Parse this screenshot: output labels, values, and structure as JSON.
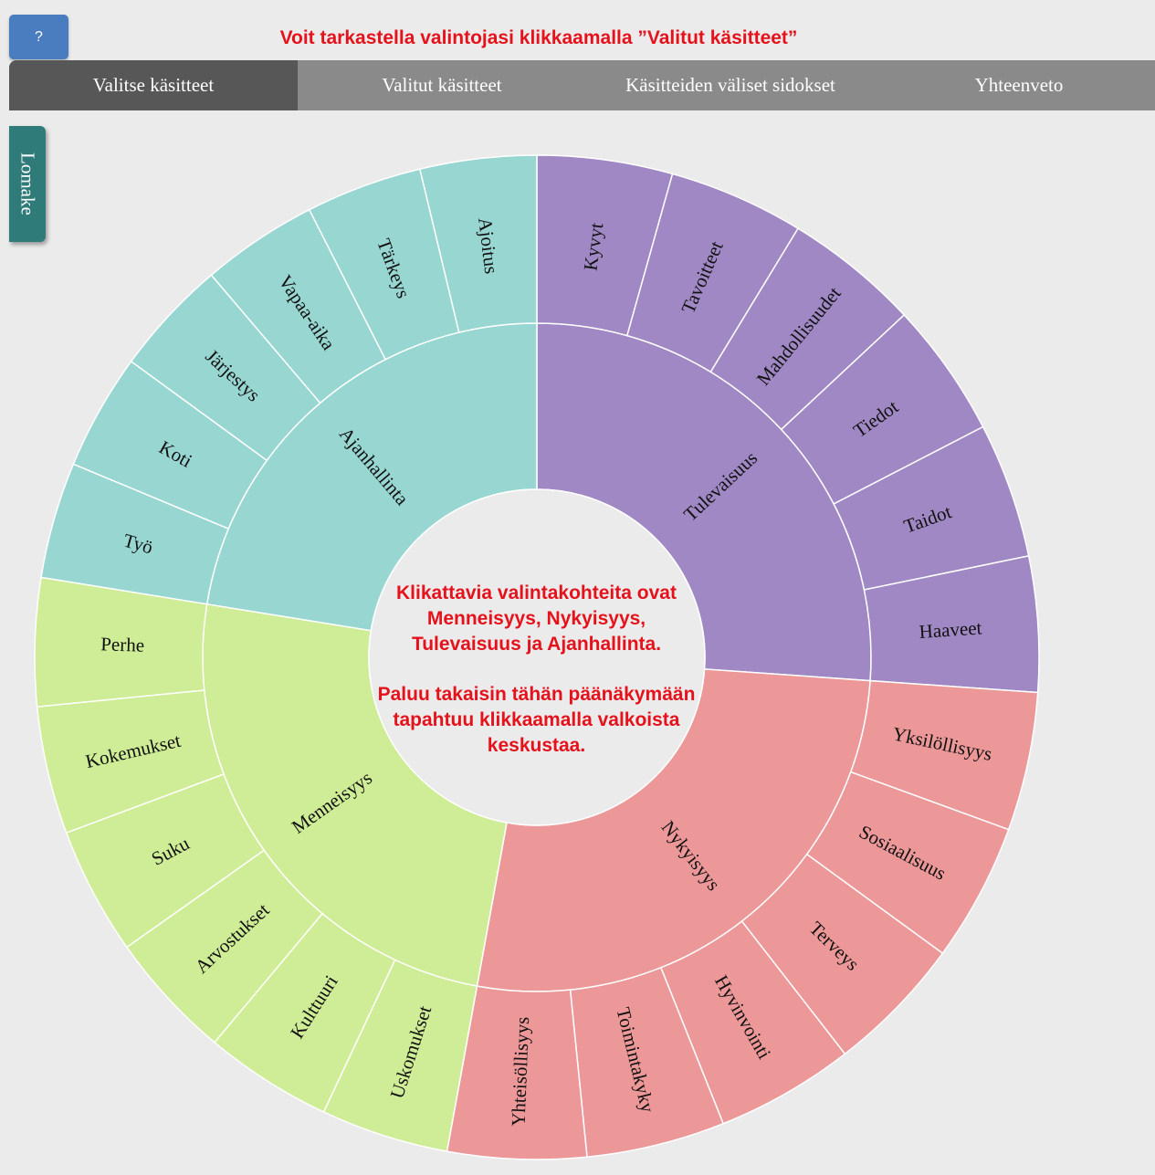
{
  "help_button": "?",
  "hint": "Voit tarkastella valintojasi klikkaamalla ”Valitut käsitteet”",
  "tabs": [
    "Valitse käsitteet",
    "Valitut käsitteet",
    "Käsitteiden väliset sidokset",
    "Yhteenveto"
  ],
  "active_tab": 0,
  "side_tab": "Lomake",
  "center": {
    "line1": "Klikattavia valintakohteita ovat Menneisyys, Nykyisyys, Tulevaisuus ja Ajanhallinta.",
    "line2": "Paluu takaisin tähän päänäkymään tapahtuu klikkaamalla valkoista keskustaa."
  },
  "colors": {
    "Tulevaisuus": "#a088c4",
    "Nykyisyys": "#ec9798",
    "Menneisyys": "#cfec96",
    "Ajanhallinta": "#98d6d2",
    "hint": "#e5121c"
  },
  "sunburst": [
    {
      "name": "Tulevaisuus",
      "children": [
        "Kyvyt",
        "Tavoitteet",
        "Mahdollisuudet",
        "Tiedot",
        "Taidot",
        "Haaveet"
      ]
    },
    {
      "name": "Nykyisyys",
      "children": [
        "Yksilöllisyys",
        "Sosiaalisuus",
        "Terveys",
        "Hyvinvointi",
        "Toimintakyky",
        "Yhteisöllisyys"
      ]
    },
    {
      "name": "Menneisyys",
      "children": [
        "Uskomukset",
        "Kulttuuri",
        "Arvostukset",
        "Suku",
        "Kokemukset",
        "Perhe"
      ]
    },
    {
      "name": "Ajanhallinta",
      "children": [
        "Työ",
        "Koti",
        "Järjestys",
        "Vapaa-aika",
        "Tärkeys",
        "Ajoitus"
      ]
    }
  ]
}
